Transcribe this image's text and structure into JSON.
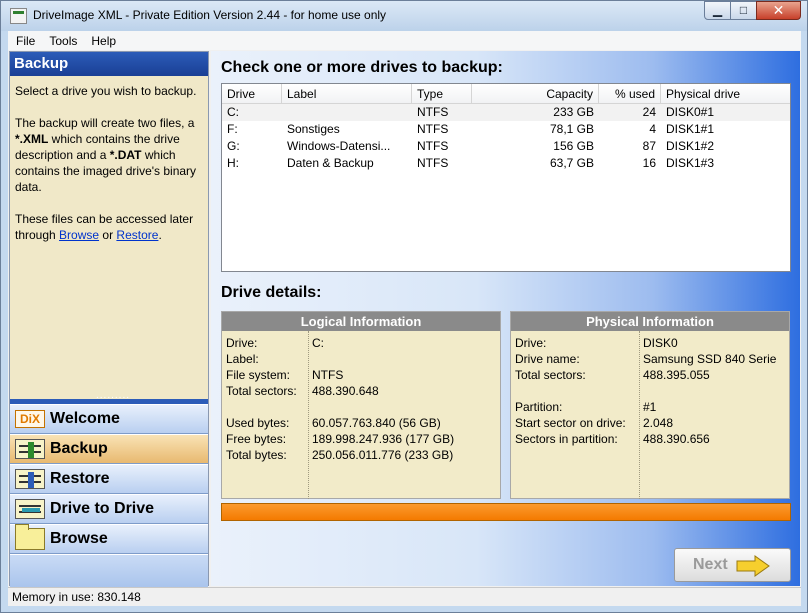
{
  "window": {
    "title": "DriveImage XML - Private Edition Version 2.44 - for home use only",
    "min_glyph": "▁",
    "max_glyph": "□",
    "close_glyph": "✕"
  },
  "menu": {
    "items": [
      {
        "label": "File"
      },
      {
        "label": "Tools"
      },
      {
        "label": "Help"
      }
    ]
  },
  "left": {
    "header": "Backup",
    "help": {
      "p1": "Select a drive you wish to backup.",
      "p2_a": "The backup will create two files, a ",
      "p2_xml": "*.XML",
      "p2_b": " which contains the drive description and a ",
      "p2_dat": "*.DAT",
      "p2_c": " which contains the imaged drive's binary data.",
      "p3_a": "These files can be accessed later through ",
      "p3_browse": "Browse",
      "p3_b": " or ",
      "p3_restore": "Restore",
      "p3_c": "."
    },
    "nav": [
      {
        "label": "Welcome",
        "icon": "dix-logo-icon",
        "icon_text": "DiX"
      },
      {
        "label": "Backup",
        "icon": "backup-icon"
      },
      {
        "label": "Restore",
        "icon": "restore-icon"
      },
      {
        "label": "Drive to Drive",
        "icon": "drive-to-drive-icon"
      },
      {
        "label": "Browse",
        "icon": "folder-icon"
      }
    ]
  },
  "main": {
    "drives_title": "Check one or more drives to backup:",
    "columns": {
      "drive": "Drive",
      "label": "Label",
      "type": "Type",
      "capacity": "Capacity",
      "used": "% used",
      "physical": "Physical drive"
    },
    "drives": [
      {
        "drive": "C:",
        "label": "",
        "type": "NTFS",
        "capacity": "233 GB",
        "used": "24",
        "physical": "DISK0#1"
      },
      {
        "drive": "F:",
        "label": "Sonstiges",
        "type": "NTFS",
        "capacity": "78,1 GB",
        "used": "4",
        "physical": "DISK1#1"
      },
      {
        "drive": "G:",
        "label": "Windows-Datensi...",
        "type": "NTFS",
        "capacity": "156 GB",
        "used": "87",
        "physical": "DISK1#2"
      },
      {
        "drive": "H:",
        "label": "Daten & Backup",
        "type": "NTFS",
        "capacity": "63,7 GB",
        "used": "16",
        "physical": "DISK1#3"
      }
    ],
    "details_title": "Drive details:",
    "logical": {
      "header": "Logical Information",
      "rows": [
        {
          "k": "Drive:",
          "v": "C:"
        },
        {
          "k": "Label:",
          "v": ""
        },
        {
          "k": "File system:",
          "v": "NTFS"
        },
        {
          "k": "Total sectors:",
          "v": "488.390.648"
        },
        {
          "k": "Used bytes:",
          "v": "60.057.763.840 (56 GB)"
        },
        {
          "k": "Free bytes:",
          "v": "189.998.247.936 (177 GB)"
        },
        {
          "k": "Total bytes:",
          "v": "250.056.011.776 (233 GB)"
        }
      ]
    },
    "physical": {
      "header": "Physical Information",
      "rows": [
        {
          "k": "Drive:",
          "v": "DISK0"
        },
        {
          "k": "Drive name:",
          "v": "Samsung SSD 840 Serie"
        },
        {
          "k": "Total sectors:",
          "v": "488.395.055"
        },
        {
          "k": "Partition:",
          "v": "#1"
        },
        {
          "k": "Start sector on drive:",
          "v": "2.048"
        },
        {
          "k": "Sectors in partition:",
          "v": "488.390.656"
        }
      ]
    },
    "progress_fraction": 1.0,
    "next_label": "Next"
  },
  "status": {
    "text": "Memory in use: 830.148"
  },
  "colors": {
    "accent": "#1a3f95",
    "progress": "#f47a00",
    "panel_bg": "#f2ebc9"
  }
}
